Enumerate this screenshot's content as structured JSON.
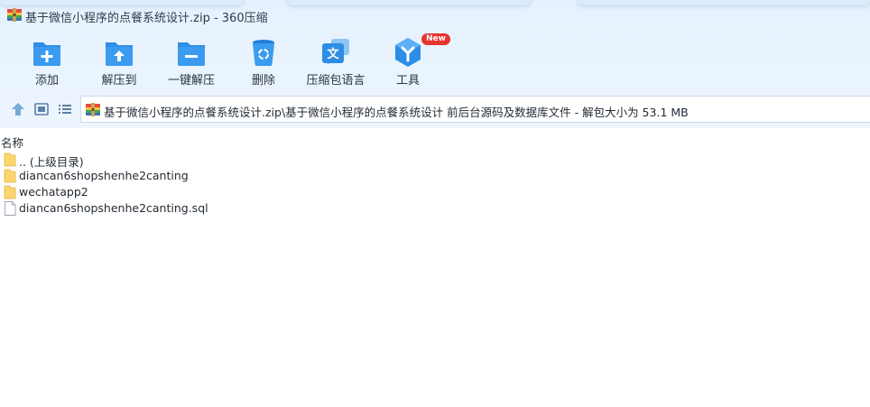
{
  "window": {
    "title": "基于微信小程序的点餐系统设计.zip - 360压缩"
  },
  "toolbar": {
    "items": [
      {
        "label": "添加",
        "icon": "add-icon"
      },
      {
        "label": "解压到",
        "icon": "extract-to-icon"
      },
      {
        "label": "一键解压",
        "icon": "one-click-extract-icon"
      },
      {
        "label": "删除",
        "icon": "delete-icon"
      },
      {
        "label": "压缩包语言",
        "icon": "language-icon"
      },
      {
        "label": "工具",
        "icon": "tools-icon",
        "badge": "New"
      }
    ],
    "accent": "#2d8ee6",
    "badge_color": "#e8332f"
  },
  "address": {
    "path": "基于微信小程序的点餐系统设计.zip\\基于微信小程序的点餐系统设计 前后台源码及数据库文件 - 解包大小为 53.1 MB"
  },
  "list": {
    "column_name": "名称",
    "rows": [
      {
        "name": ".. (上级目录)",
        "type": "folder"
      },
      {
        "name": "diancan6shopshenhe2canting",
        "type": "folder"
      },
      {
        "name": "wechatapp2",
        "type": "folder"
      },
      {
        "name": "diancan6shopshenhe2canting.sql",
        "type": "file"
      }
    ]
  }
}
